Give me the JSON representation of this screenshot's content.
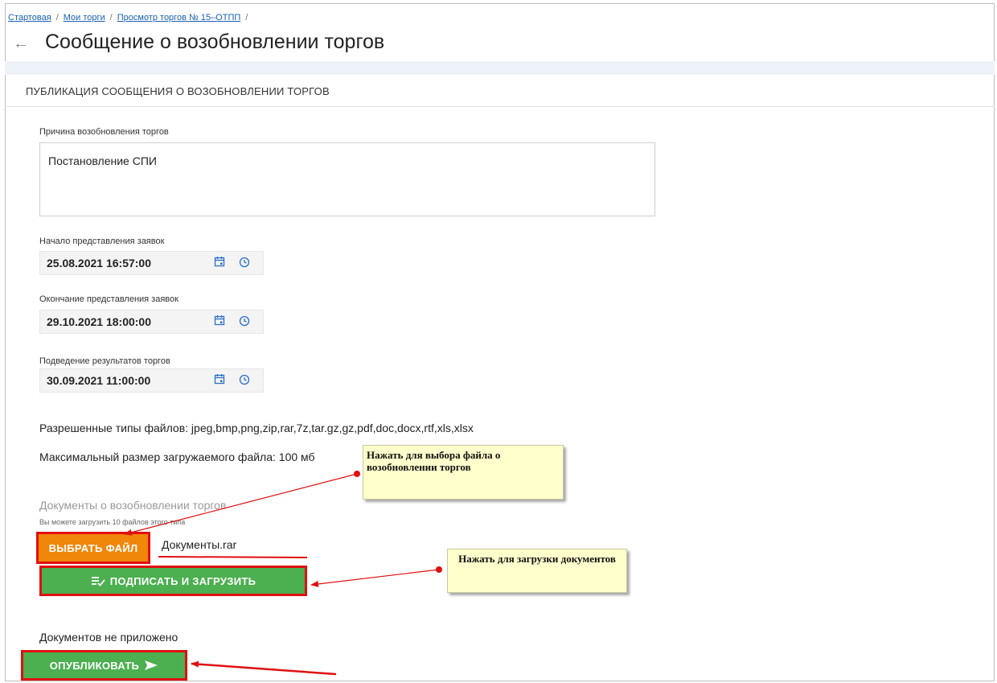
{
  "breadcrumb": {
    "items": [
      "Стартовая",
      "Мои торги",
      "Просмотр торгов № 15–ОТПП"
    ],
    "separator": "/"
  },
  "header": {
    "title": "Сообщение о возобновлении торгов"
  },
  "section": {
    "title": "ПУБЛИКАЦИЯ СООБЩЕНИЯ О ВОЗОБНОВЛЕНИИ ТОРГОВ"
  },
  "form": {
    "reason_label": "Причина возобновления торгов",
    "reason_value": "Постановление СПИ",
    "start_label": "Начало представления заявок",
    "start_value": "25.08.2021 16:57:00",
    "end_label": "Окончание представления заявок",
    "end_value": "29.10.2021 18:00:00",
    "results_label": "Подведение результатов торгов",
    "results_value": "30.09.2021 11:00:00"
  },
  "files": {
    "allowed_types": "Разрешенные типы файлов: jpeg,bmp,png,zip,rar,7z,tar.gz,gz,pdf,doc,docx,rtf,xls,xlsx",
    "max_size": "Максимальный размер загружаемого файла: 100 мб",
    "docs_title": "Документы о возобновлении торгов",
    "docs_note": "Вы можете загрузить 10 файлов этого типа",
    "choose_label": "ВЫБРАТЬ ФАЙЛ",
    "file_name": "Документы.rar",
    "sign_label": "ПОДПИСАТЬ И ЗАГРУЗИТЬ",
    "no_docs": "Документов не приложено",
    "publish_label": "ОПУБЛИКОВАТЬ"
  },
  "annotations": {
    "note_choose": "Нажать для выбора файла о возобновлении торгов",
    "note_upload": "Нажать для загрузки документов"
  },
  "colors": {
    "orange_button": "#f0860a",
    "green_button": "#4caf50",
    "highlight_red": "#e01010",
    "note_background": "#ffffcc",
    "link_blue": "#1a5fb4"
  },
  "icons": [
    "back-arrow-icon",
    "calendar-icon",
    "clock-icon",
    "sign-icon",
    "send-icon"
  ]
}
